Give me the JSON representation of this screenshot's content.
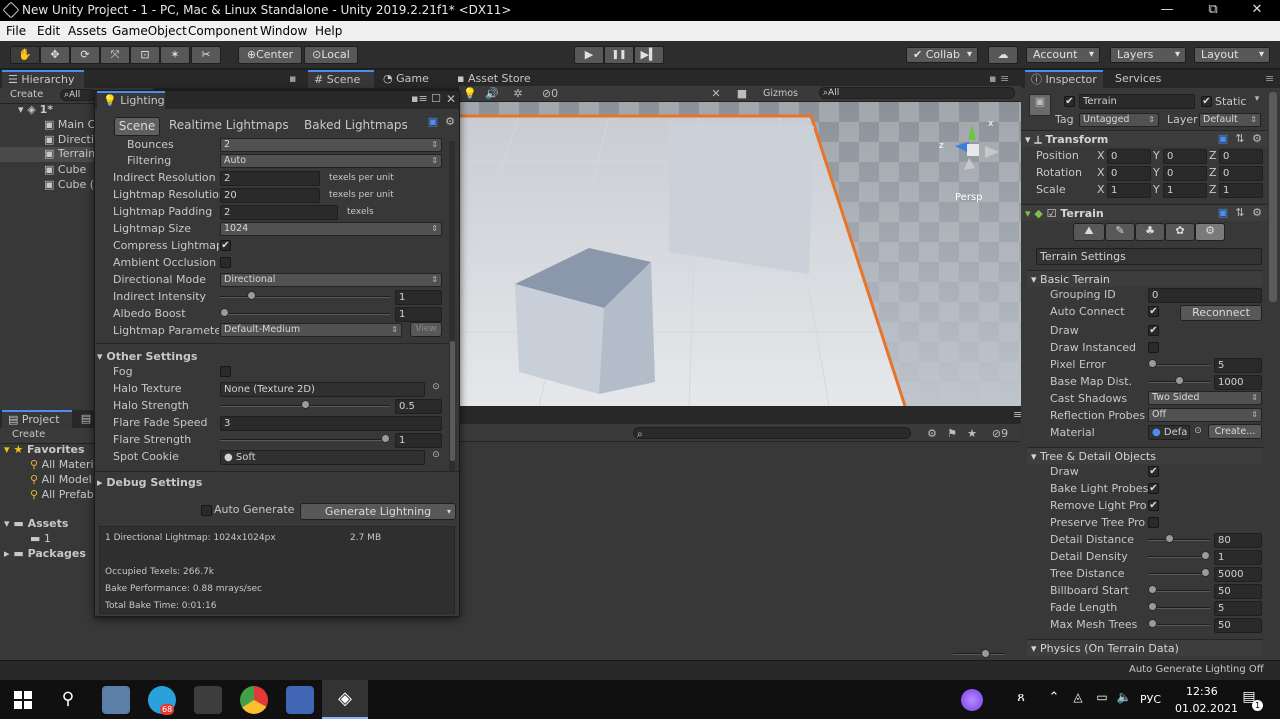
{
  "title_bar": {
    "title": "New Unity Project - 1 - PC, Mac & Linux Standalone - Unity 2019.2.21f1* <DX11>",
    "minimize": "—",
    "maximize": "⧉",
    "close": "✕"
  },
  "menu": [
    "File",
    "Edit",
    "Assets",
    "GameObject",
    "Component",
    "Window",
    "Help"
  ],
  "toolbar": {
    "tools": [
      "✋",
      "✥",
      "⟳",
      "⤧",
      "⊡",
      "✶"
    ],
    "pivot": "Center",
    "space": "Local",
    "play": "▶",
    "pause": "❚❚",
    "step": "▶▍",
    "collab": "Collab",
    "account": "Account",
    "layers": "Layers",
    "layout": "Layout"
  },
  "hierarchy": {
    "tab": "Hierarchy",
    "create": "Create",
    "search": "All",
    "scene": "1*",
    "items": [
      "Main C",
      "Directi",
      "Terrain",
      "Cube",
      "Cube ("
    ]
  },
  "project": {
    "tab": "Project",
    "create": "Create",
    "favorites": "Favorites",
    "fav_items": [
      "All Materi",
      "All Model",
      "All Prefab"
    ],
    "assets": "Assets",
    "asset_items": [
      "1"
    ],
    "packages": "Packages"
  },
  "scene_tabs": {
    "scene": "Scene",
    "game": "Game",
    "asset_store": "Asset Store",
    "gizmos": "Gizmos",
    "search": "All",
    "hidden_count": "0",
    "persp": "Persp",
    "axis_x": "x",
    "axis_z": "z"
  },
  "console_bar": {
    "count": "9"
  },
  "lighting": {
    "title": "Lighting",
    "tabs": [
      "Scene",
      "Realtime Lightmaps",
      "Baked Lightmaps"
    ],
    "rows": {
      "bounces": {
        "label": "Bounces",
        "value": "2"
      },
      "filtering": {
        "label": "Filtering",
        "value": "Auto"
      },
      "indirect_res": {
        "label": "Indirect Resolution",
        "value": "2",
        "unit": "texels per unit"
      },
      "lightmap_res": {
        "label": "Lightmap Resolution",
        "value": "20",
        "unit": "texels per unit"
      },
      "padding": {
        "label": "Lightmap Padding",
        "value": "2",
        "unit": "texels"
      },
      "size": {
        "label": "Lightmap Size",
        "value": "1024"
      },
      "compress": {
        "label": "Compress Lightmaps",
        "checked": "✔"
      },
      "ao": {
        "label": "Ambient Occlusion"
      },
      "dir_mode": {
        "label": "Directional Mode",
        "value": "Directional"
      },
      "indirect_int": {
        "label": "Indirect Intensity",
        "value": "1",
        "level": 0.17
      },
      "albedo": {
        "label": "Albedo Boost",
        "value": "1",
        "level": 0.0
      },
      "params": {
        "label": "Lightmap Parameters",
        "value": "Default-Medium",
        "view": "View"
      }
    },
    "other": {
      "header": "Other Settings",
      "fog": {
        "label": "Fog"
      },
      "halo_tex": {
        "label": "Halo Texture",
        "value": "None (Texture 2D)"
      },
      "halo_str": {
        "label": "Halo Strength",
        "value": "0.5",
        "level": 0.5
      },
      "flare_fade": {
        "label": "Flare Fade Speed",
        "value": "3"
      },
      "flare_str": {
        "label": "Flare Strength",
        "value": "1",
        "level": 1.0
      },
      "spot": {
        "label": "Spot Cookie",
        "value": "Soft"
      }
    },
    "debug": "Debug Settings",
    "auto_generate": "Auto Generate",
    "generate": "Generate Lightning",
    "stats": {
      "lightmap": "1 Directional Lightmap: 1024x1024px",
      "size": "2.7 MB",
      "texels": "Occupied Texels: 266.7k",
      "perf": "Bake Performance: 0.88 mrays/sec",
      "time": "Total Bake Time: 0:01:16"
    }
  },
  "inspector": {
    "tab": "Inspector",
    "services": "Services",
    "name": "Terrain",
    "static": "Static",
    "tag_label": "Tag",
    "tag": "Untagged",
    "layer_label": "Layer",
    "layer": "Default",
    "transform": {
      "title": "Transform",
      "rows": [
        {
          "label": "Position",
          "x": "0",
          "y": "0",
          "z": "0"
        },
        {
          "label": "Rotation",
          "x": "0",
          "y": "0",
          "z": "0"
        },
        {
          "label": "Scale",
          "x": "1",
          "y": "1",
          "z": "1"
        }
      ]
    },
    "terrain_comp": "Terrain",
    "terrain_settings": "Terrain Settings",
    "basic": {
      "header": "Basic Terrain",
      "grouping_id": {
        "label": "Grouping ID",
        "value": "0"
      },
      "auto_connect": {
        "label": "Auto Connect",
        "button": "Reconnect"
      },
      "draw": {
        "label": "Draw"
      },
      "draw_instanced": {
        "label": "Draw Instanced"
      },
      "pixel_error": {
        "label": "Pixel Error",
        "value": "5",
        "level": 0.0
      },
      "base_map": {
        "label": "Base Map Dist.",
        "value": "1000",
        "level": 0.5
      },
      "cast_shadows": {
        "label": "Cast Shadows",
        "value": "Two Sided"
      },
      "reflection": {
        "label": "Reflection Probes",
        "value": "Off"
      },
      "material": {
        "label": "Material",
        "value": "Defa",
        "create": "Create..."
      }
    },
    "tree": {
      "header": "Tree & Detail Objects",
      "draw": {
        "label": "Draw"
      },
      "bake_probes": {
        "label": "Bake Light Probes"
      },
      "remove_probes": {
        "label": "Remove Light Prob"
      },
      "preserve": {
        "label": "Preserve Tree Pro"
      },
      "detail_dist": {
        "label": "Detail Distance",
        "value": "80",
        "level": 0.32
      },
      "detail_density": {
        "label": "Detail Density",
        "value": "1",
        "level": 1.0
      },
      "tree_dist": {
        "label": "Tree Distance",
        "value": "5000",
        "level": 1.0
      },
      "billboard": {
        "label": "Billboard Start",
        "value": "50",
        "level": 0.0
      },
      "fade": {
        "label": "Fade Length",
        "value": "5",
        "level": 0.0
      },
      "max_mesh": {
        "label": "Max Mesh Trees",
        "value": "50",
        "level": 0.0
      }
    },
    "physics": "Physics (On Terrain Data)"
  },
  "status": "Auto Generate Lighting Off",
  "taskbar": {
    "lang": "РУС",
    "time": "12:36",
    "date": "01.02.2021",
    "notif": "1",
    "telegram_badge": "68"
  },
  "colors": {
    "accent": "#4b8ef0",
    "terrain_edge": "#e8742a",
    "panel": "#383838"
  }
}
